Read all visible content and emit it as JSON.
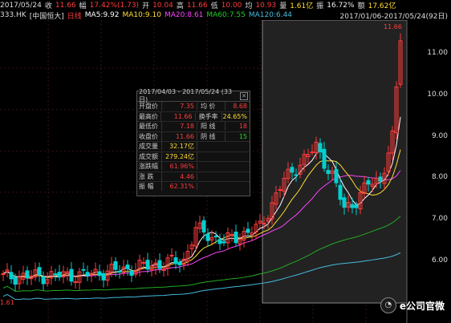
{
  "topbar": {
    "date": "2017/05/24",
    "close_label": "收",
    "close_val": "11.66",
    "chg_label": "幅",
    "chg_val": "17.42%(1.73)",
    "open_label": "开",
    "open_val": "10.04",
    "high_label": "高",
    "high_val": "11.66",
    "low_label": "低",
    "low_val": "10.00",
    "avg_label": "均",
    "avg_val": "10.93",
    "vol_label": "量",
    "vol_val": "1.61亿",
    "amp_label": "振",
    "amp_val": "16.72%",
    "amt_label": "额",
    "amt_val": "17.62亿"
  },
  "secbar": {
    "code": "333.HK",
    "name": "[中国恒大]",
    "period": "日线",
    "ma5": "MA5:9.92",
    "ma10": "MA10:9.10",
    "ma20": "MA20:8.61",
    "ma60": "MA60:7.55",
    "ma120": "MA120:6.44",
    "range": "2017/01/06-2017/05/24(92日)"
  },
  "colors": {
    "up": "#ff3b3b",
    "down": "#00d0d0",
    "ma5": "#ffffff",
    "ma10": "#ffdd33",
    "ma20": "#ff44ff",
    "ma60": "#22aa22",
    "ma120": "#44bbdd"
  },
  "axis": {
    "labels": [
      "11.00",
      "10.00",
      "9.00",
      "8.00",
      "7.00",
      "6.00"
    ],
    "high_marker": "11.66",
    "low_marker": "1.61"
  },
  "infobox": {
    "title": "2017/04/03 - 2017/05/24 (33日)",
    "rows": [
      {
        "l": "开盘价",
        "v": "7.35",
        "l2": "均 价",
        "v2": "8.68"
      },
      {
        "l": "最高价",
        "v": "11.66",
        "l2": "换手率",
        "v2": "24.65%"
      },
      {
        "l": "最低价",
        "v": "7.18",
        "l2": "阳 线",
        "v2": "18"
      },
      {
        "l": "收盘价",
        "v": "11.66",
        "l2": "阴 线",
        "v2": "15"
      },
      {
        "l": "成交量",
        "v": "32.17亿"
      },
      {
        "l": "成交额",
        "v": "279.24亿"
      },
      {
        "l": "涨跌幅",
        "v": "61.96%"
      },
      {
        "l": "涨 跌",
        "v": "4.46"
      },
      {
        "l": "振 幅",
        "v": "62.31%"
      }
    ]
  },
  "logo": {
    "text": "e公司官微"
  }
}
